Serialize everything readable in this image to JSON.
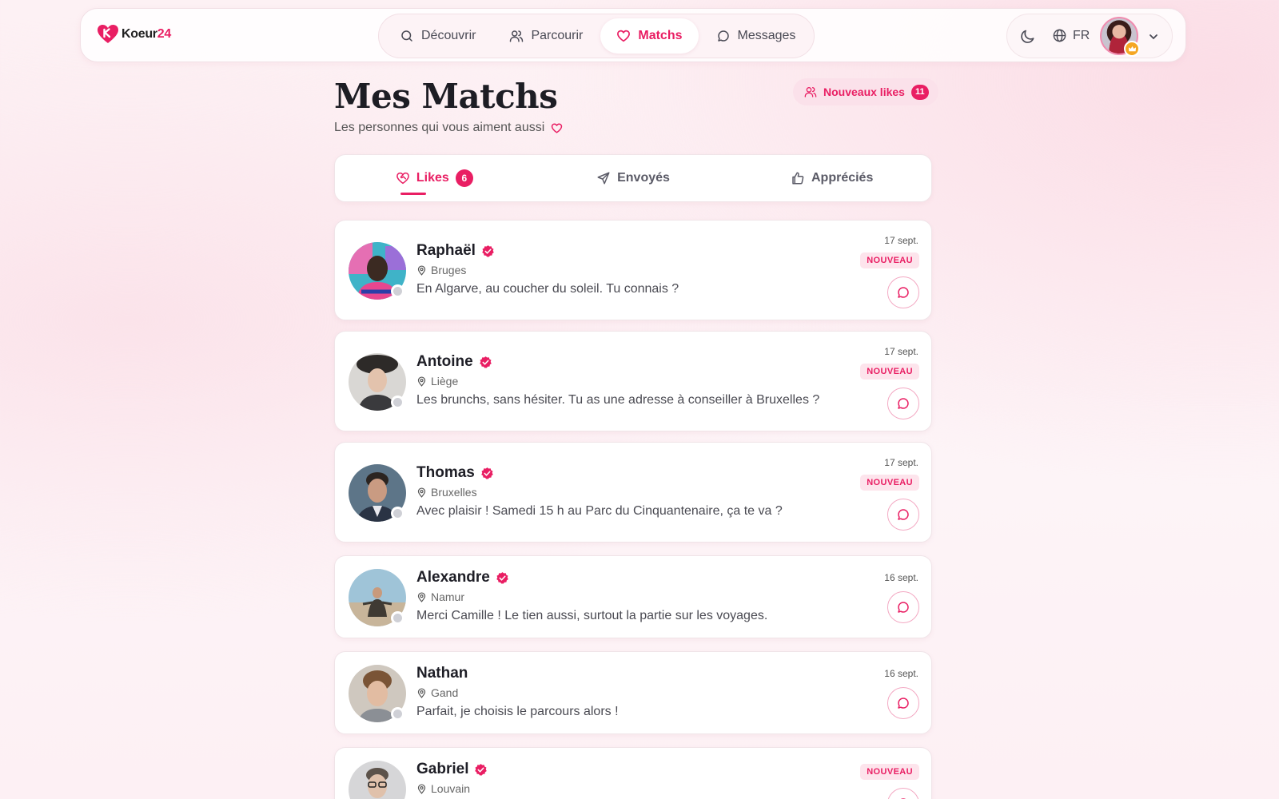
{
  "brand": {
    "name_prefix": "Koeur",
    "name_suffix": "24"
  },
  "nav": {
    "items": [
      {
        "label": "Découvrir",
        "icon": "search-icon"
      },
      {
        "label": "Parcourir",
        "icon": "users-icon"
      },
      {
        "label": "Matchs",
        "icon": "heart-icon",
        "active": true
      },
      {
        "label": "Messages",
        "icon": "chat-bubble-icon"
      }
    ]
  },
  "header": {
    "language": "FR"
  },
  "page": {
    "title": "Mes Matchs",
    "subtitle": "Les personnes qui vous aiment aussi",
    "new_likes_label": "Nouveaux likes",
    "new_likes_count": "11"
  },
  "tabs": [
    {
      "label": "Likes",
      "badge": "6",
      "active": true
    },
    {
      "label": "Envoyés"
    },
    {
      "label": "Appréciés"
    }
  ],
  "matches": [
    {
      "name": "Raphaël",
      "verified": true,
      "location": "Bruges",
      "message": "En Algarve, au coucher du soleil. Tu connais ?",
      "date": "17 sept.",
      "badge": "NOUVEAU"
    },
    {
      "name": "Antoine",
      "verified": true,
      "location": "Liège",
      "message": "Les brunchs, sans hésiter. Tu as une adresse à conseiller à Bruxelles ?",
      "date": "17 sept.",
      "badge": "NOUVEAU"
    },
    {
      "name": "Thomas",
      "verified": true,
      "location": "Bruxelles",
      "message": "Avec plaisir ! Samedi 15 h au Parc du Cinquantenaire, ça te va ?",
      "date": "17 sept.",
      "badge": "NOUVEAU"
    },
    {
      "name": "Alexandre",
      "verified": true,
      "location": "Namur",
      "message": "Merci Camille ! Le tien aussi, surtout la partie sur les voyages.",
      "date": "16 sept.",
      "badge": ""
    },
    {
      "name": "Nathan",
      "verified": false,
      "location": "Gand",
      "message": "Parfait, je choisis le parcours alors !",
      "date": "16 sept.",
      "badge": ""
    },
    {
      "name": "Gabriel",
      "verified": true,
      "location": "Louvain",
      "message": "",
      "date": "",
      "badge": "NOUVEAU"
    }
  ],
  "colors": {
    "accent": "#e91e63",
    "badge_bg": "#fde4ec"
  }
}
